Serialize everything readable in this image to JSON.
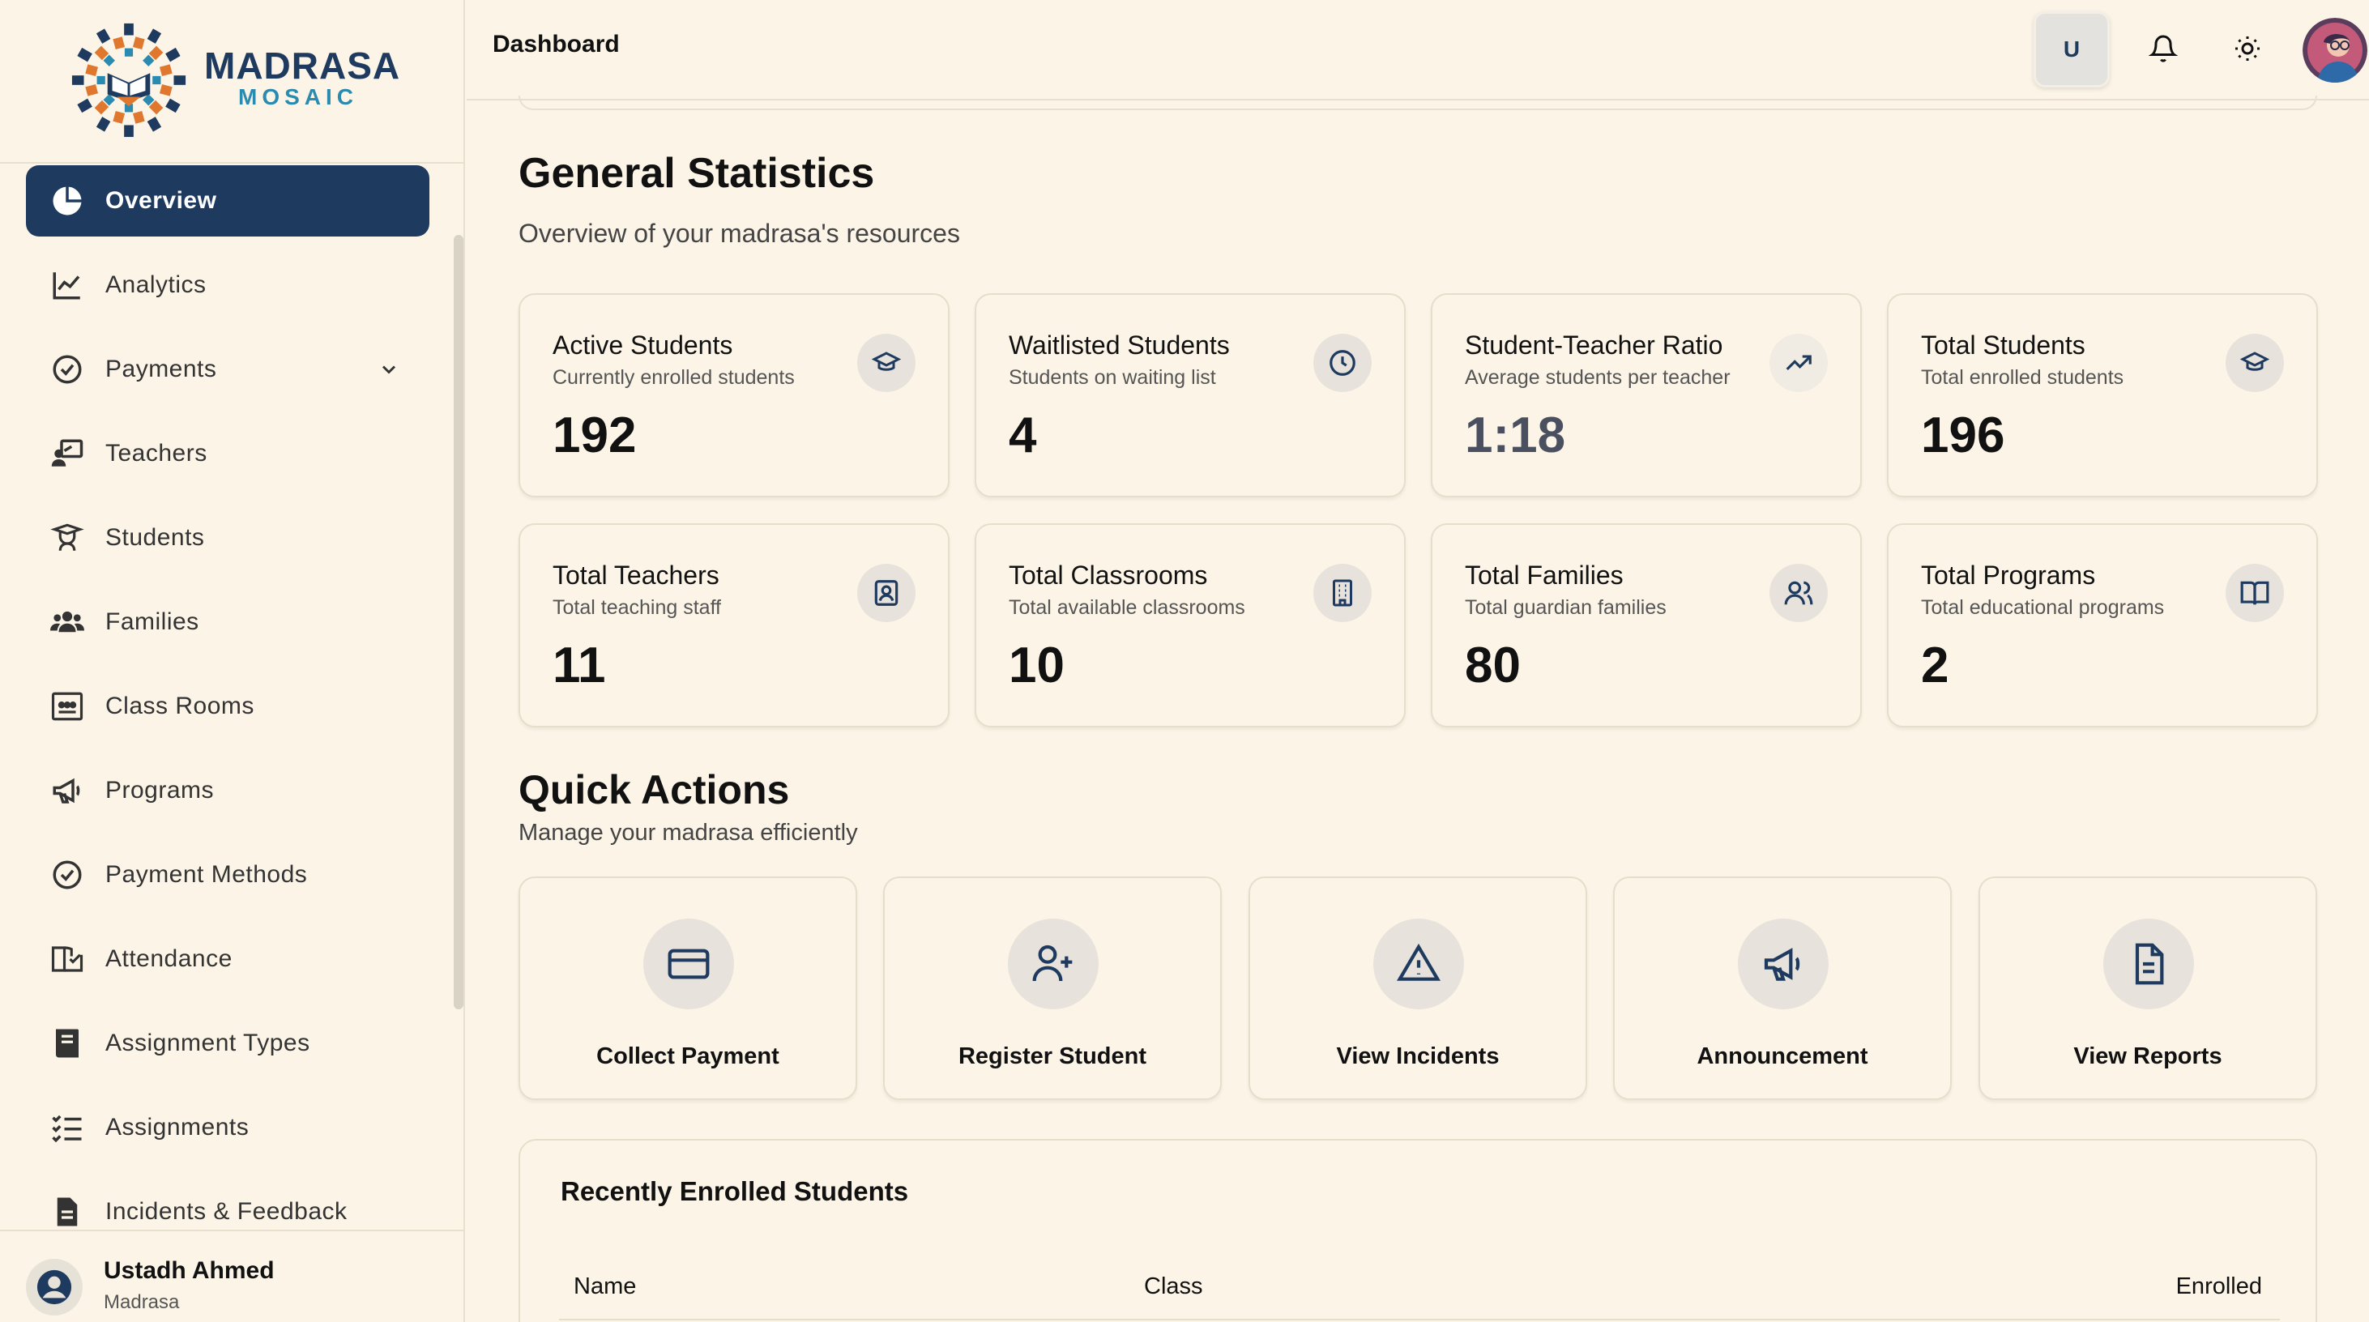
{
  "brand": {
    "name": "MADRASA",
    "sub": "MOSAIC"
  },
  "sidebar": {
    "items": [
      {
        "label": "Overview",
        "icon": "pie-chart-icon"
      },
      {
        "label": "Analytics",
        "icon": "line-chart-icon"
      },
      {
        "label": "Payments",
        "icon": "check-circle-icon"
      },
      {
        "label": "Teachers",
        "icon": "teacher-icon"
      },
      {
        "label": "Students",
        "icon": "student-icon"
      },
      {
        "label": "Families",
        "icon": "users-icon"
      },
      {
        "label": "Class Rooms",
        "icon": "classroom-icon"
      },
      {
        "label": "Programs",
        "icon": "megaphone-icon"
      },
      {
        "label": "Payment Methods",
        "icon": "check-circle-icon"
      },
      {
        "label": "Attendance",
        "icon": "attendance-icon"
      },
      {
        "label": "Assignment Types",
        "icon": "book-icon"
      },
      {
        "label": "Assignments",
        "icon": "list-check-icon"
      },
      {
        "label": "Incidents & Feedback",
        "icon": "document-icon"
      }
    ],
    "user": {
      "name": "Ustadh Ahmed",
      "role": "Madrasa"
    }
  },
  "header": {
    "title": "Dashboard",
    "user_initial": "U"
  },
  "stats": {
    "title": "General Statistics",
    "subtitle": "Overview of your madrasa's resources",
    "cards": [
      {
        "title": "Active Students",
        "desc": "Currently enrolled students",
        "value": "192",
        "icon": "graduation-cap-icon"
      },
      {
        "title": "Waitlisted Students",
        "desc": "Students on waiting list",
        "value": "4",
        "icon": "clock-icon"
      },
      {
        "title": "Student-Teacher Ratio",
        "desc": "Average students per teacher",
        "value": "1:18",
        "icon": "trending-up-icon"
      },
      {
        "title": "Total Students",
        "desc": "Total enrolled students",
        "value": "196",
        "icon": "graduation-cap-icon"
      },
      {
        "title": "Total Teachers",
        "desc": "Total teaching staff",
        "value": "11",
        "icon": "contact-icon"
      },
      {
        "title": "Total Classrooms",
        "desc": "Total available classrooms",
        "value": "10",
        "icon": "building-icon"
      },
      {
        "title": "Total Families",
        "desc": "Total guardian families",
        "value": "80",
        "icon": "users-icon"
      },
      {
        "title": "Total Programs",
        "desc": "Total educational programs",
        "value": "2",
        "icon": "book-open-icon"
      }
    ]
  },
  "quick_actions": {
    "title": "Quick Actions",
    "subtitle": "Manage your madrasa efficiently",
    "items": [
      {
        "label": "Collect Payment",
        "icon": "credit-card-icon"
      },
      {
        "label": "Register Student",
        "icon": "user-plus-icon"
      },
      {
        "label": "View Incidents",
        "icon": "alert-triangle-icon"
      },
      {
        "label": "Announcement",
        "icon": "megaphone-icon"
      },
      {
        "label": "View Reports",
        "icon": "file-text-icon"
      }
    ]
  },
  "recent": {
    "title": "Recently Enrolled Students",
    "columns": [
      "Name",
      "Class",
      "Enrolled"
    ]
  },
  "colors": {
    "primary": "#1e3a5f",
    "background": "#fcf5e7",
    "accent": "#2a8ab0"
  }
}
